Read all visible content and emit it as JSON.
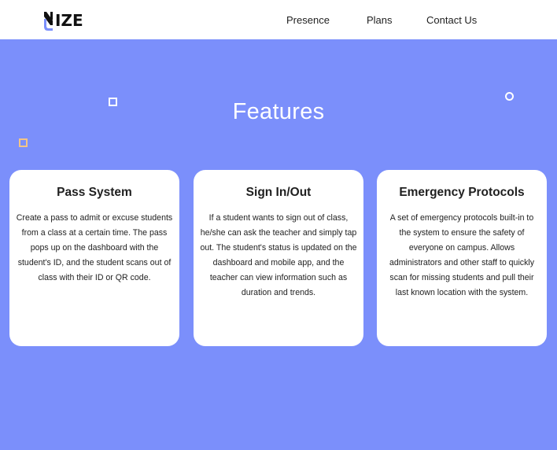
{
  "brand": {
    "logo_text": "IZE"
  },
  "nav": {
    "links": [
      {
        "label": "Presence"
      },
      {
        "label": "Plans"
      },
      {
        "label": "Contact Us"
      }
    ]
  },
  "features": {
    "title": "Features",
    "cards": [
      {
        "title": "Pass System",
        "body": "Create a pass to admit or excuse students from a class at a certain time. The pass pops up on the dashboard with the student's ID, and the student scans out of class with their ID or QR code."
      },
      {
        "title": "Sign In/Out",
        "body": "If a student wants to sign out of class, he/she can ask the teacher and simply tap out. The student's status is updated on the dashboard and mobile app, and the teacher can view information such as duration and trends."
      },
      {
        "title": "Emergency Protocols",
        "body": "A set of emergency protocols built-in to the system to ensure the safety of everyone on campus. Allows administrators and other staff to quickly scan for missing students and pull their last known location with the system."
      }
    ]
  },
  "colors": {
    "background": "#7b8ffb",
    "navbar": "#ffffff",
    "card": "#ffffff",
    "accent_orange": "#f3c587",
    "logo_accent": "#7b8ffb"
  },
  "icons": {
    "logo_mark": "logo-mark-icon",
    "deco_square_white": "square-outline-icon",
    "deco_square_orange": "square-outline-icon",
    "deco_circle_white": "circle-outline-icon"
  }
}
